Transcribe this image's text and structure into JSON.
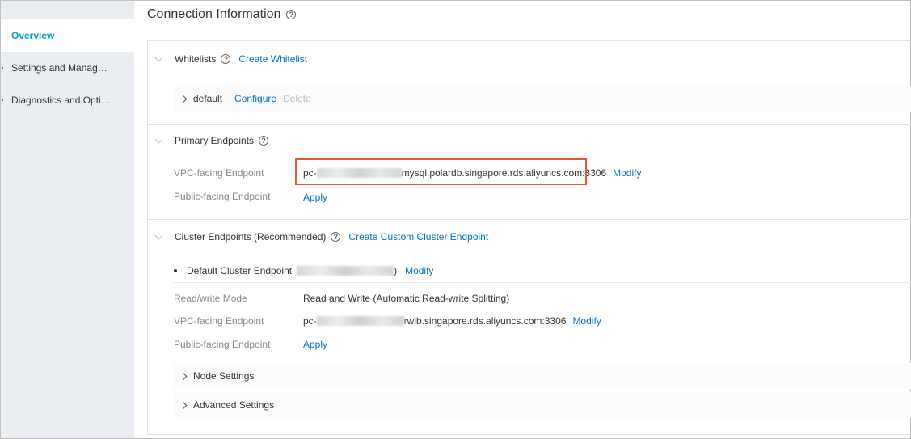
{
  "sidebar": {
    "items": [
      {
        "label": "Overview"
      },
      {
        "label": "Settings and Manag…"
      },
      {
        "label": "Diagnostics and Opti…"
      }
    ]
  },
  "header": {
    "title": "Connection Information",
    "help_icon": "question-circle-icon"
  },
  "whitelists": {
    "title": "Whitelists",
    "create_link": "Create Whitelist",
    "group": {
      "name": "default",
      "configure": "Configure",
      "delete": "Delete"
    }
  },
  "primary": {
    "title": "Primary Endpoints",
    "vpc_label": "VPC-facing Endpoint",
    "vpc_prefix": "pc-",
    "vpc_suffix": "mysql.polardb.singapore.rds.aliyuncs.com",
    "vpc_port": ":3306",
    "modify": "Modify",
    "public_label": "Public-facing Endpoint",
    "apply": "Apply"
  },
  "cluster": {
    "title": "Cluster Endpoints (Recommended)",
    "create_link": "Create Custom Cluster Endpoint",
    "default_label": "Default Cluster Endpoint",
    "paren_close": ")",
    "modify": "Modify",
    "rw_label": "Read/write Mode",
    "rw_value": "Read and Write (Automatic Read-write Splitting)",
    "vpc_label": "VPC-facing Endpoint",
    "vpc_prefix": "pc-",
    "vpc_suffix": "rwlb.singapore.rds.aliyuncs.com:3306",
    "vpc_modify": "Modify",
    "public_label": "Public-facing Endpoint",
    "apply": "Apply",
    "node_settings": "Node Settings",
    "advanced_settings": "Advanced Settings"
  },
  "colors": {
    "accent": "#00a2ca",
    "link": "#0070cc",
    "highlight_box": "#e8563a"
  }
}
